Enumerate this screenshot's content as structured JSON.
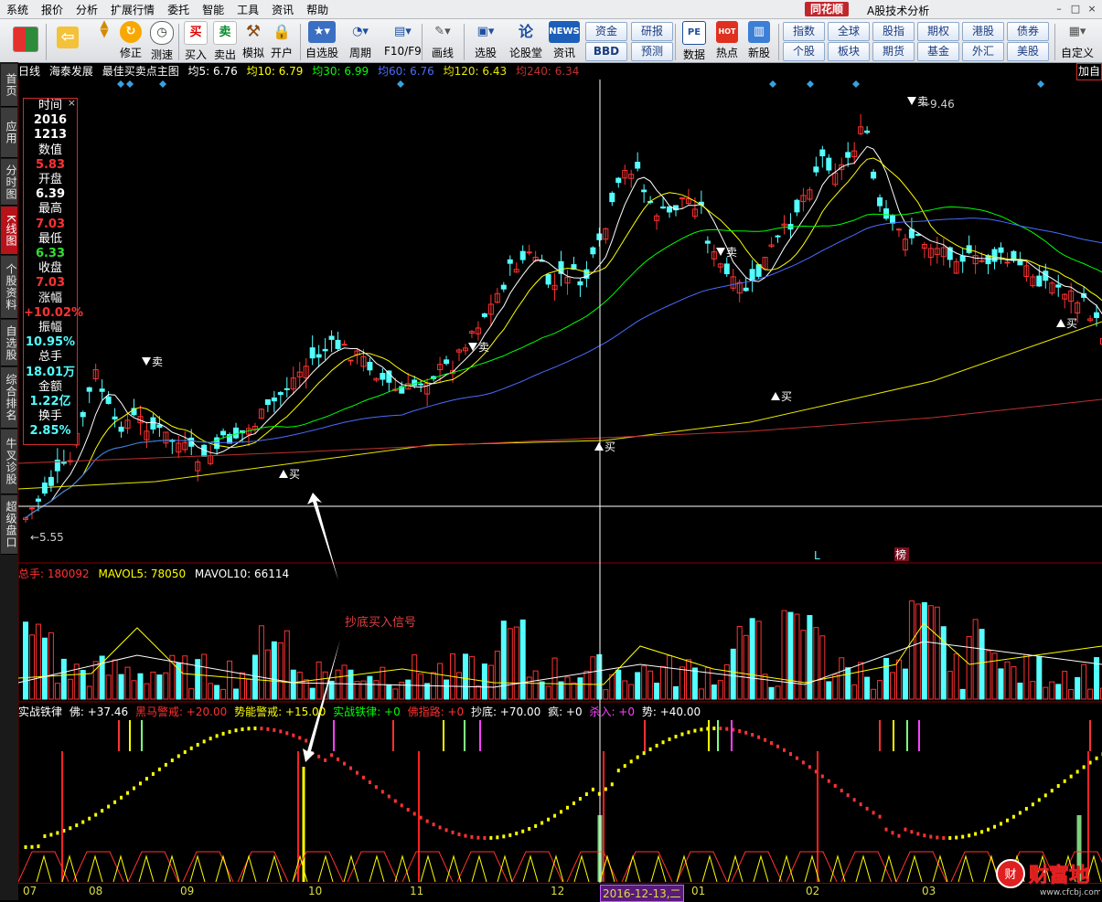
{
  "menu": [
    "系统",
    "报价",
    "分析",
    "扩展行情",
    "委托",
    "智能",
    "工具",
    "资讯",
    "帮助"
  ],
  "brand": {
    "logo": "同花顺",
    "subtitle": "A股技术分析"
  },
  "toolbar": {
    "buttons": [
      {
        "label": "",
        "icon": "color-grid-icon"
      },
      {
        "label": "",
        "icon": "back-arrow-icon"
      },
      {
        "label": "",
        "icon": "up-down-icon"
      },
      {
        "label": "修正",
        "icon": "refresh-icon"
      },
      {
        "label": "测速",
        "icon": "clock-icon"
      },
      {
        "label": "买入",
        "icon": "buy-icon",
        "glyph": "买"
      },
      {
        "label": "卖出",
        "icon": "sell-icon",
        "glyph": "卖"
      },
      {
        "label": "模拟",
        "icon": "hammer-icon"
      },
      {
        "label": "开户",
        "icon": "lock-icon"
      },
      {
        "label": "自选股",
        "icon": "star-icon"
      },
      {
        "label": "周期",
        "icon": "cycle-icon"
      },
      {
        "label": "F10/F9",
        "icon": "f10-icon"
      },
      {
        "label": "画线",
        "icon": "pen-icon"
      },
      {
        "label": "选股",
        "icon": "screen-icon"
      },
      {
        "label": "论股堂",
        "icon": "forum-icon"
      },
      {
        "label": "资讯",
        "icon": "news-icon",
        "glyph": "NEWS"
      },
      {
        "label": "数据",
        "icon": "pe-icon",
        "glyph": "PE"
      },
      {
        "label": "热点",
        "icon": "hot-icon",
        "glyph": "HOT"
      },
      {
        "label": "新股",
        "icon": "newstock-icon"
      },
      {
        "label": "自定义",
        "icon": "custom-icon"
      }
    ],
    "quick_row1": [
      "资金",
      "研报",
      "指数",
      "全球",
      "股指",
      "期权",
      "港股",
      "债券"
    ],
    "quick_row2": [
      "BBD",
      "预测",
      "个股",
      "板块",
      "期货",
      "基金",
      "外汇",
      "美股"
    ]
  },
  "left_tabs": [
    "首页",
    "应用",
    "分时图",
    "K线图",
    "个股资料",
    "自选股",
    "综合排名",
    "牛叉诊股",
    "超级盘口"
  ],
  "header": {
    "period": "日线",
    "stock": "海泰发展",
    "indicator": "最佳买卖点主图",
    "ma": [
      {
        "label": "均5: 6.76",
        "color": "#ffffff"
      },
      {
        "label": "均10: 6.79",
        "color": "#ffff00"
      },
      {
        "label": "均30: 6.99",
        "color": "#00ff00"
      },
      {
        "label": "均60: 6.76",
        "color": "#4a6cff"
      },
      {
        "label": "均120: 6.43",
        "color": "#e8e800"
      },
      {
        "label": "均240: 6.34",
        "color": "#c03030"
      }
    ],
    "add_label": "加自"
  },
  "info": {
    "time_label": "时间",
    "date_year": "2016",
    "date_md": "1213",
    "value_label": "数值",
    "value": "5.83",
    "open_label": "开盘",
    "open": "6.39",
    "high_label": "最高",
    "high": "7.03",
    "low_label": "最低",
    "low": "6.33",
    "close_label": "收盘",
    "close": "7.03",
    "chg_label": "涨幅",
    "chg": "+10.02%",
    "amp_label": "振幅",
    "amp": "10.95%",
    "vol_label": "总手",
    "vol": "18.01万",
    "amt_label": "金额",
    "amt": "1.22亿",
    "turn_label": "换手",
    "turn": "2.85%"
  },
  "price_annotations": {
    "max": "9.46",
    "min": "5.55",
    "buy": "买",
    "sell": "卖",
    "L": "L",
    "bang": "榜"
  },
  "volume": {
    "total": "总手: 180092",
    "ma5": "MAVOL5: 78050",
    "ma10": "MAVOL10: 66114"
  },
  "indicator_line": [
    {
      "label": "实战铁律",
      "color": "#ffffff"
    },
    {
      "label": "佛: +37.46",
      "color": "#ffffff"
    },
    {
      "label": "黑马警戒: +20.00",
      "color": "#ff3030"
    },
    {
      "label": "势能警戒: +15.00",
      "color": "#ffff00"
    },
    {
      "label": "实战铁律: +0",
      "color": "#00ff00"
    },
    {
      "label": "佛指路: +0",
      "color": "#ff3030"
    },
    {
      "label": "抄底: +70.00",
      "color": "#ffffff"
    },
    {
      "label": "疯: +0",
      "color": "#ffffff"
    },
    {
      "label": "杀入: +0",
      "color": "#ff40ff"
    },
    {
      "label": "势: +40.00",
      "color": "#ffffff"
    }
  ],
  "annotation": "抄底买入信号",
  "xaxis": [
    "07",
    "08",
    "09",
    "10",
    "11",
    "12",
    "01",
    "02",
    "03"
  ],
  "cursor_date": "2016-12-13,二",
  "watermark": {
    "text": "财富地",
    "url": "www.cfcbj.com"
  },
  "colors": {
    "up": "#ff3232",
    "down": "#54ffff",
    "bg": "#000000",
    "grid": "#8b0000"
  }
}
